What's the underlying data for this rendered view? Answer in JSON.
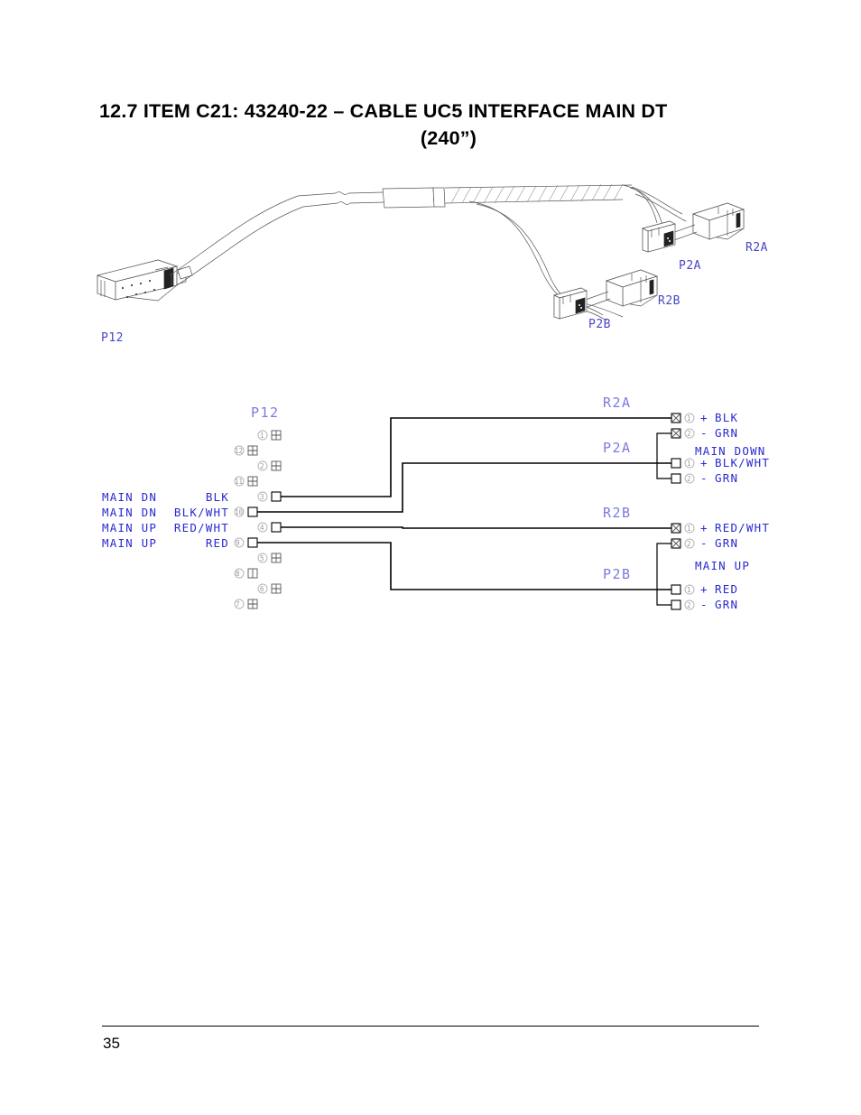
{
  "heading": {
    "line1": "12.7  ITEM C21:  43240-22 – CABLE UC5 INTERFACE MAIN DT",
    "line2": "(240”)"
  },
  "illustration": {
    "labels": {
      "p12": "P12",
      "p2a": "P2A",
      "r2a": "R2A",
      "p2b": "P2B",
      "r2b": "R2B"
    }
  },
  "schematic": {
    "source_connector": {
      "name": "P12",
      "pin_order": [
        1,
        12,
        2,
        11,
        3,
        10,
        4,
        9,
        5,
        8,
        6,
        7
      ],
      "connected_pins": [
        {
          "pin": "3",
          "function": "MAIN DN",
          "wire": "BLK",
          "goes_to": "R2A-1"
        },
        {
          "pin": "10",
          "function": "MAIN DN",
          "wire": "BLK/WHT",
          "goes_to": "P2A-1"
        },
        {
          "pin": "4",
          "function": "MAIN UP",
          "wire": "RED/WHT",
          "goes_to": "R2B-1"
        },
        {
          "pin": "9",
          "function": "MAIN UP",
          "wire": "RED",
          "goes_to": "P2B-1"
        }
      ]
    },
    "destination_connectors": [
      {
        "name": "R2A",
        "type": "receptacle",
        "pins": [
          {
            "pin": "1",
            "polarity": "+",
            "wire": "BLK"
          },
          {
            "pin": "2",
            "polarity": "-",
            "wire": "GRN"
          }
        ]
      },
      {
        "name": "P2A",
        "type": "plug",
        "pins": [
          {
            "pin": "1",
            "polarity": "+",
            "wire": "BLK/WHT"
          },
          {
            "pin": "2",
            "polarity": "-",
            "wire": "GRN"
          }
        ]
      },
      {
        "name": "R2B",
        "type": "receptacle",
        "pins": [
          {
            "pin": "1",
            "polarity": "+",
            "wire": "RED/WHT"
          },
          {
            "pin": "2",
            "polarity": "-",
            "wire": "GRN"
          }
        ]
      },
      {
        "name": "P2B",
        "type": "plug",
        "pins": [
          {
            "pin": "1",
            "polarity": "+",
            "wire": "RED"
          },
          {
            "pin": "2",
            "polarity": "-",
            "wire": "GRN"
          }
        ]
      }
    ],
    "group_annotations": [
      {
        "text": "MAIN DOWN",
        "group": "A"
      },
      {
        "text": "MAIN UP",
        "group": "B"
      }
    ]
  },
  "footer": {
    "page_number": "35"
  },
  "colors": {
    "label_blue": "#2a2ad0",
    "connector_blue": "#7b7be0",
    "pin_gray": "#9a9a9a",
    "wire_black": "#000000"
  }
}
